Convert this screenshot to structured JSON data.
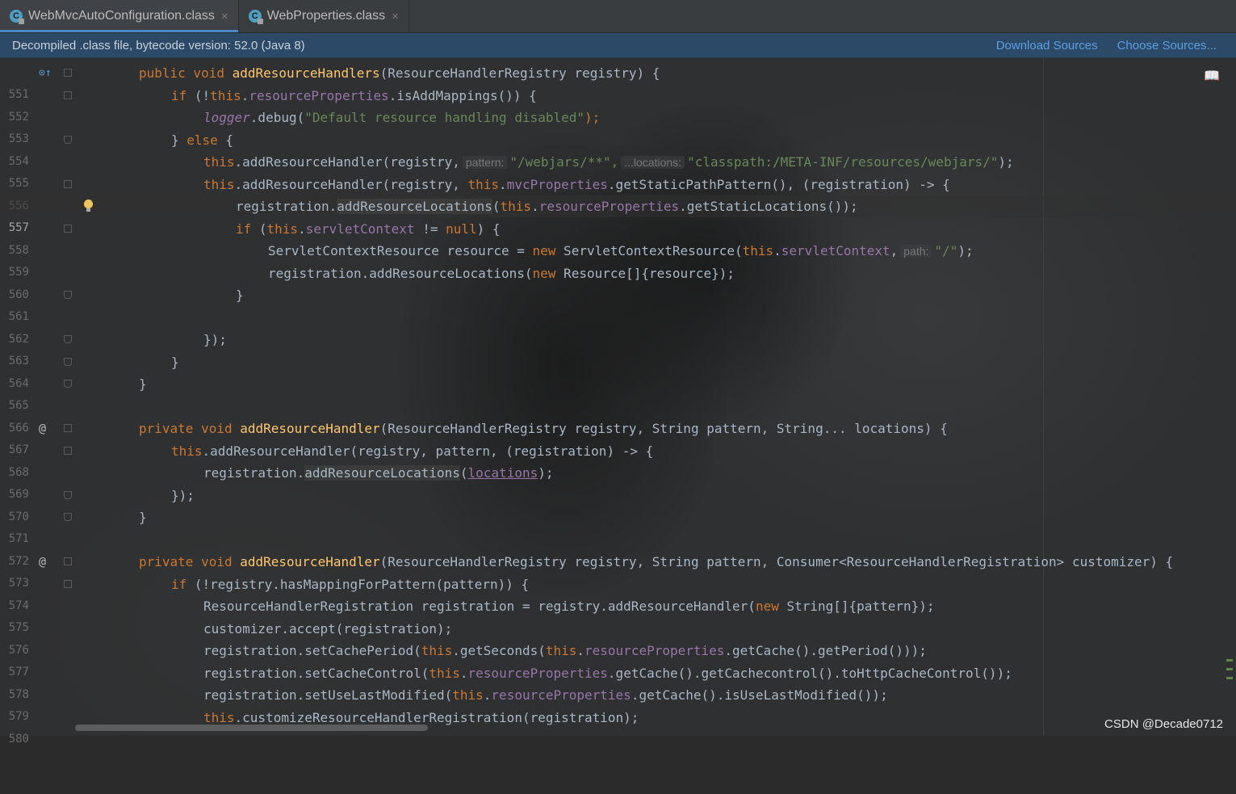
{
  "tabs": [
    {
      "label": "WebMvcAutoConfiguration.class",
      "active": true
    },
    {
      "label": "WebProperties.class",
      "active": false
    }
  ],
  "tab_icon_glyph": "C",
  "tab_close_glyph": "×",
  "banner": {
    "text": "Decompiled .class file, bytecode version: 52.0 (Java 8)",
    "download_sources": "Download Sources",
    "choose_sources": "Choose Sources..."
  },
  "lines": [
    {
      "n": "551"
    },
    {
      "n": "552"
    },
    {
      "n": "553"
    },
    {
      "n": "554"
    },
    {
      "n": "555"
    },
    {
      "n": "556"
    },
    {
      "n": "557"
    },
    {
      "n": "558"
    },
    {
      "n": "559"
    },
    {
      "n": "560"
    },
    {
      "n": "561"
    },
    {
      "n": "562"
    },
    {
      "n": "563"
    },
    {
      "n": "564"
    },
    {
      "n": "565"
    },
    {
      "n": "566"
    },
    {
      "n": "567"
    },
    {
      "n": "568"
    },
    {
      "n": "569"
    },
    {
      "n": "570"
    },
    {
      "n": "571"
    },
    {
      "n": "572"
    },
    {
      "n": "573"
    },
    {
      "n": "574"
    },
    {
      "n": "575"
    },
    {
      "n": "576"
    },
    {
      "n": "577"
    },
    {
      "n": "578"
    },
    {
      "n": "579"
    },
    {
      "n": "580"
    }
  ],
  "code": {
    "l551": [
      "public void ",
      "addResourceHandlers",
      "(ResourceHandlerRegistry registry) {"
    ],
    "l552": [
      "if",
      " (!",
      "this",
      ".",
      "resourceProperties",
      ".isAddMappings()) {"
    ],
    "l553": [
      "logger",
      ".debug(",
      "\"Default resource handling disabled\"",
      ");"
    ],
    "l554": [
      "} ",
      "else",
      " {"
    ],
    "l555": [
      "this",
      ".addResourceHandler(registry,",
      "pattern:",
      "\"/webjars/**\",",
      "...locations:",
      "\"classpath:/META-INF/resources/webjars/\"",
      ");"
    ],
    "l556": [
      "this",
      ".addResourceHandler(registry, ",
      "this",
      ".",
      "mvcProperties",
      ".getStaticPathPattern(), (registration) -> {"
    ],
    "l557": [
      "registration.",
      "addResourceLocations",
      "(",
      "this",
      ".",
      "resourceProperties",
      ".getStaticLocations());"
    ],
    "l558": [
      "if",
      " (",
      "this",
      ".",
      "servletContext",
      " != ",
      "null",
      ") {"
    ],
    "l559": [
      "ServletContextResource resource = ",
      "new",
      " ServletContextResource(",
      "this",
      ".",
      "servletContext",
      ",",
      "path:",
      "\"/\"",
      ");"
    ],
    "l560": [
      "registration.addResourceLocations(",
      "new",
      " Resource[]{resource});"
    ],
    "l561": [
      "}"
    ],
    "l563": [
      "});"
    ],
    "l564": [
      "}"
    ],
    "l565": [
      "}"
    ],
    "l567": [
      "private void ",
      "addResourceHandler",
      "(ResourceHandlerRegistry registry, String pattern, String... locations) {"
    ],
    "l568": [
      "this",
      ".addResourceHandler(registry, pattern, (registration) -> {"
    ],
    "l569": [
      "registration.",
      "addResourceLocations",
      "(",
      "locations",
      ");"
    ],
    "l570": [
      "});"
    ],
    "l571": [
      "}"
    ],
    "l573": [
      "private void ",
      "addResourceHandler",
      "(ResourceHandlerRegistry registry, String pattern, Consumer<ResourceHandlerRegistration> customizer) {"
    ],
    "l574": [
      "if",
      " (!registry.hasMappingForPattern(pattern)) {"
    ],
    "l575": [
      "ResourceHandlerRegistration registration = registry.addResourceHandler(",
      "new",
      " String[]{pattern});"
    ],
    "l576": [
      "customizer.accept(registration);"
    ],
    "l577": [
      "registration.setCachePeriod(",
      "this",
      ".getSeconds(",
      "this",
      ".",
      "resourceProperties",
      ".getCache().getPeriod()));"
    ],
    "l578": [
      "registration.setCacheControl(",
      "this",
      ".",
      "resourceProperties",
      ".getCache().getCachecontrol().toHttpCacheControl());"
    ],
    "l579": [
      "registration.setUseLastModified(",
      "this",
      ".",
      "resourceProperties",
      ".getCache().isUseLastModified());"
    ],
    "l580": [
      "this",
      ".customizeResourceHandlerRegistration(registration);"
    ]
  },
  "gutter_icons": {
    "override": "⊙↑",
    "annotation": "@"
  },
  "reader_icon_glyph": "📖",
  "watermark": "CSDN @Decade0712",
  "colors": {
    "keyword": "#cc7832",
    "method": "#ffc66d",
    "field": "#9876aa",
    "string": "#6a8759",
    "text": "#a9b7c6",
    "link": "#5a9fe6"
  }
}
